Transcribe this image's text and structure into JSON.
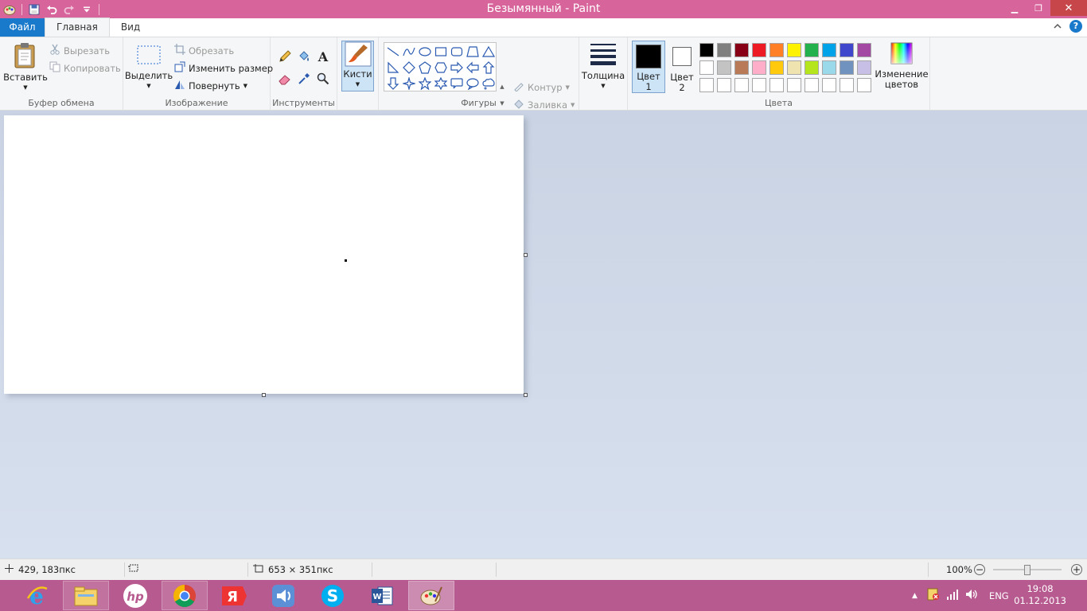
{
  "window": {
    "title": "Безымянный - Paint",
    "minimize": "▁",
    "restore": "❐",
    "close": "✕"
  },
  "tabs": {
    "file": "Файл",
    "home": "Главная",
    "view": "Вид"
  },
  "help": "?",
  "clipboard": {
    "paste": "Вставить",
    "cut": "Вырезать",
    "copy": "Копировать",
    "label": "Буфер обмена"
  },
  "image": {
    "select": "Выделить",
    "crop": "Обрезать",
    "resize": "Изменить размер",
    "rotate": "Повернуть",
    "label": "Изображение"
  },
  "tools": {
    "label": "Инструменты",
    "text_tool_glyph": "A"
  },
  "brushes": {
    "label": "Кисти"
  },
  "shapes": {
    "label": "Фигуры",
    "outline": "Контур",
    "fill": "Заливка"
  },
  "size": {
    "label": "Толщина"
  },
  "colors": {
    "color1_line1": "Цвет",
    "color1_line2": "1",
    "color2_line1": "Цвет",
    "color2_line2": "2",
    "color1_value": "#000000",
    "color2_value": "#ffffff",
    "edit_line1": "Изменение",
    "edit_line2": "цветов",
    "label": "Цвета",
    "palette": [
      "#000000",
      "#7f7f7f",
      "#880015",
      "#ed1c24",
      "#ff7f27",
      "#fff200",
      "#22b14c",
      "#00a2e8",
      "#3f48cc",
      "#a349a4",
      "#ffffff",
      "#c3c3c3",
      "#b97a57",
      "#ffaec9",
      "#ffc90e",
      "#efe4b0",
      "#b5e61d",
      "#99d9ea",
      "#7092be",
      "#c8bfe7",
      "#ffffff",
      "#ffffff",
      "#ffffff",
      "#ffffff",
      "#ffffff",
      "#ffffff",
      "#ffffff",
      "#ffffff",
      "#ffffff",
      "#ffffff"
    ]
  },
  "status": {
    "cursor_pos": "429, 183пкс",
    "image_size": "653 × 351пкс",
    "zoom": "100%",
    "zoom_minus": "−",
    "zoom_plus": "+"
  },
  "taskbar": {
    "lang": "ENG",
    "time": "19:08",
    "date": "01.12.2013"
  }
}
